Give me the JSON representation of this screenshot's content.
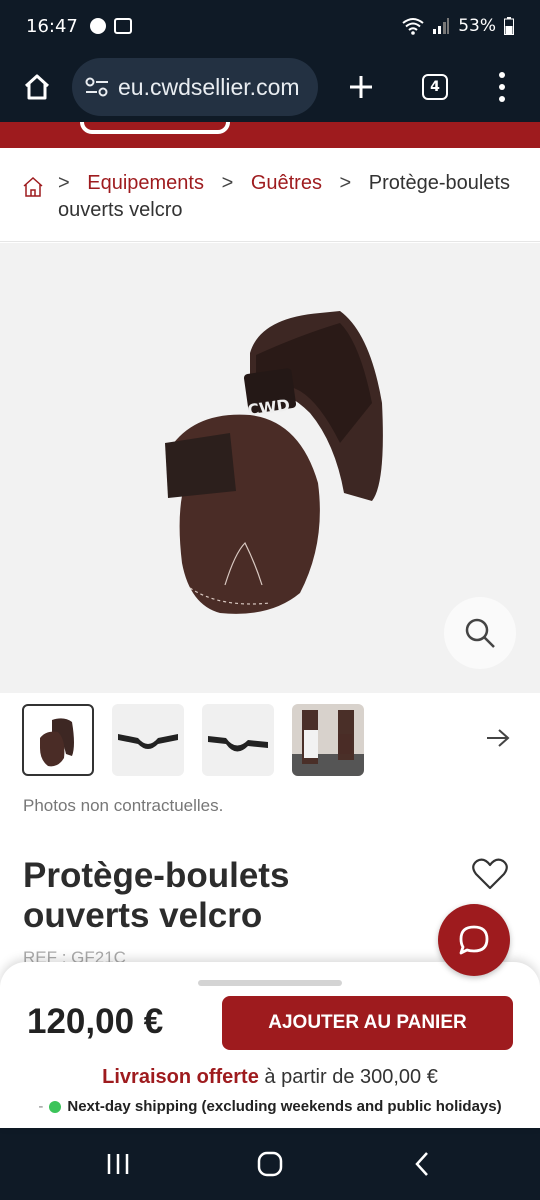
{
  "status": {
    "time": "16:47",
    "battery": "53%"
  },
  "browser": {
    "url": "eu.cwdsellier.com",
    "tab_count": "4"
  },
  "breadcrumb": {
    "separator": ">",
    "items": [
      "Equipements",
      "Guêtres",
      "Protège-boulets ouverts velcro"
    ]
  },
  "product": {
    "photos_note": "Photos non contractuelles.",
    "title": "Protège-boulets ouverts velcro",
    "ref": "REF : GF21C",
    "brand_mark": "CWD",
    "price": "120,00 €",
    "add_to_cart": "AJOUTER AU PANIER"
  },
  "shipping": {
    "offer": "Livraison offerte",
    "condition": " à partir de 300,00 €",
    "dash": "-",
    "nextday": "Next-day shipping (excluding weekends and public holidays)"
  },
  "colors": {
    "brand": "#9e1b1e",
    "system_bar": "#0f1a26",
    "status_green": "#3bc45a"
  },
  "icons": [
    "home-icon",
    "tune-icon",
    "plus-icon",
    "tabs-icon",
    "more-vert-icon",
    "house-outline-icon",
    "zoom-icon",
    "arrow-right-icon",
    "heart-icon",
    "chat-icon",
    "recents-icon",
    "home-circle-icon",
    "back-icon"
  ]
}
